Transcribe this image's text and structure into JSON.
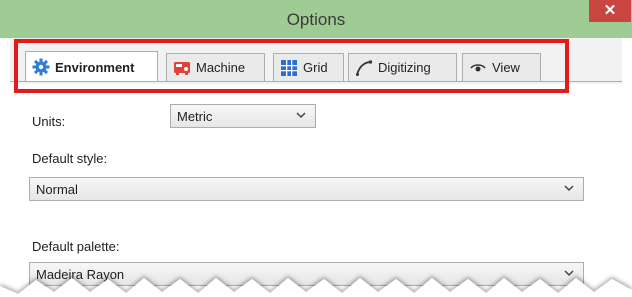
{
  "window": {
    "title": "Options",
    "close_glyph": "✕"
  },
  "tabs": [
    {
      "label": "Environment",
      "icon": "gear-icon",
      "active": true
    },
    {
      "label": "Machine",
      "icon": "machine-icon",
      "active": false
    },
    {
      "label": "Grid",
      "icon": "grid-icon",
      "active": false
    },
    {
      "label": "Digitizing",
      "icon": "digitizing-curve-icon",
      "active": false
    },
    {
      "label": "View",
      "icon": "eye-icon",
      "active": false
    }
  ],
  "form": {
    "units": {
      "label": "Units:",
      "value": "Metric"
    },
    "default_style": {
      "label": "Default style:",
      "value": "Normal"
    },
    "default_palette": {
      "label": "Default palette:",
      "value": "Madeira Rayon"
    }
  },
  "colors": {
    "titlebar": "#9fcc95",
    "close": "#c9453f",
    "highlight": "#e21b1b",
    "gear": "#2f7fd6",
    "machine": "#e0433a",
    "grid": "#2b6fd0"
  }
}
